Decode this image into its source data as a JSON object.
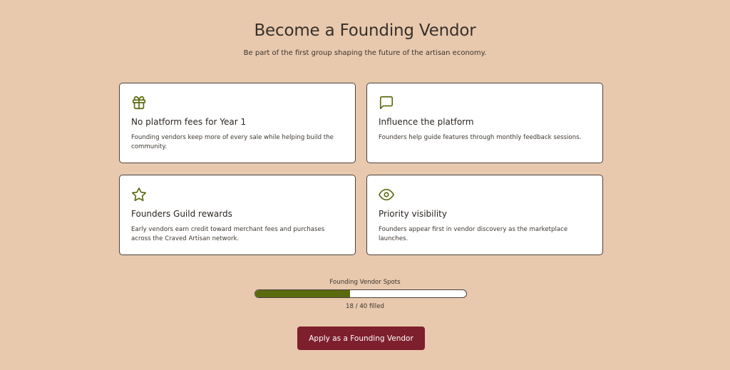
{
  "header": {
    "title": "Become a Founding Vendor",
    "subtitle": "Be part of the first group shaping the future of the artisan economy."
  },
  "benefits": [
    {
      "icon": "gift-icon",
      "title": "No platform fees for Year 1",
      "description": "Founding vendors keep more of every sale while helping build the community."
    },
    {
      "icon": "message-icon",
      "title": "Influence the platform",
      "description": "Founders help guide features through monthly feedback sessions."
    },
    {
      "icon": "star-icon",
      "title": "Founders Guild rewards",
      "description": "Early vendors earn credit toward merchant fees and purchases across the Craved Artisan network."
    },
    {
      "icon": "eye-icon",
      "title": "Priority visibility",
      "description": "Founders appear first in vendor discovery as the marketplace launches."
    }
  ],
  "progress": {
    "label": "Founding Vendor Spots",
    "filled": 18,
    "total": 40,
    "count_text": "18 / 40 filled"
  },
  "cta": {
    "label": "Apply as a Founding Vendor"
  },
  "colors": {
    "background": "#e8c9ae",
    "accent_green": "#5a6a0f",
    "button": "#7e1f2d"
  }
}
